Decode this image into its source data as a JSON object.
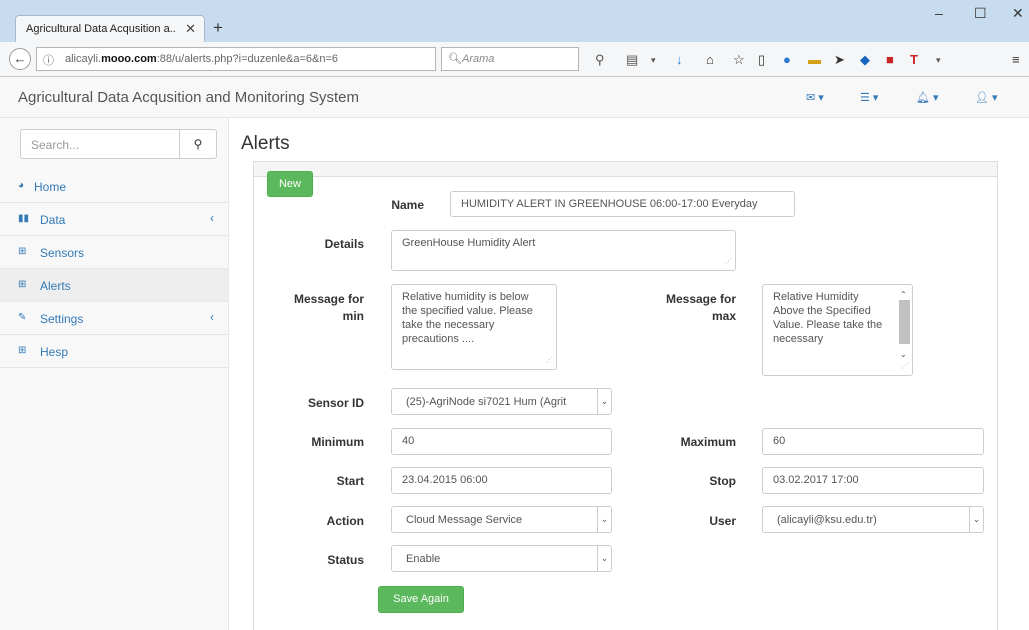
{
  "browser": {
    "tab_title": "Agricultural Data Acqusition a...",
    "tab_close": "✕",
    "new_tab": "+",
    "url_prefix": "alicayli.",
    "url_domain": "mooo.com",
    "url_rest": ":88/u/alerts.php?i=duzenle&a=6&n=6",
    "search_placeholder": "Arama"
  },
  "app": {
    "brand": "Agricultural Data Acqusition and Monitoring System"
  },
  "sidebar": {
    "search_placeholder": "Search...",
    "items": [
      {
        "label": "Home",
        "icon": "dashboard-icon"
      },
      {
        "label": "Data",
        "icon": "bar-chart-icon",
        "arrow": "‹"
      },
      {
        "label": "Sensors",
        "icon": "table-icon"
      },
      {
        "label": "Alerts",
        "icon": "table-icon"
      },
      {
        "label": "Settings",
        "icon": "edit-icon",
        "arrow": "‹"
      },
      {
        "label": "Hesp",
        "icon": "table-icon"
      }
    ]
  },
  "main": {
    "title": "Alerts",
    "new_button": "New",
    "form": {
      "name_label": "Name",
      "name_value": "HUMIDITY ALERT IN GREENHOUSE 06:00-17:00 Everyday",
      "details_label": "Details",
      "details_value": "GreenHouse Humidity Alert",
      "msg_min_label": "Message for min",
      "msg_min_value": "Relative humidity is below the specified value. Please take the necessary precautions ....",
      "msg_max_label": "Message for max",
      "msg_max_value": "Relative Humidity Above the Specified Value. Please take the necessary",
      "sensor_label": "Sensor ID",
      "sensor_value": "(25)-AgriNode si7021 Hum (Agrit",
      "minimum_label": "Minimum",
      "minimum_value": "40",
      "maximum_label": "Maximum",
      "maximum_value": "60",
      "start_label": "Start",
      "start_value": "23.04.2015 06:00",
      "stop_label": "Stop",
      "stop_value": "03.02.2017 17:00",
      "action_label": "Action",
      "action_value": "Cloud Message Service",
      "user_label": "User",
      "user_value": "(alicayli@ksu.edu.tr)",
      "status_label": "Status",
      "status_value": "Enable",
      "save_button": "Save Again"
    }
  },
  "colors": {
    "link": "#337ab7",
    "success": "#5cb85c",
    "tabbar": "#c7dcef"
  }
}
